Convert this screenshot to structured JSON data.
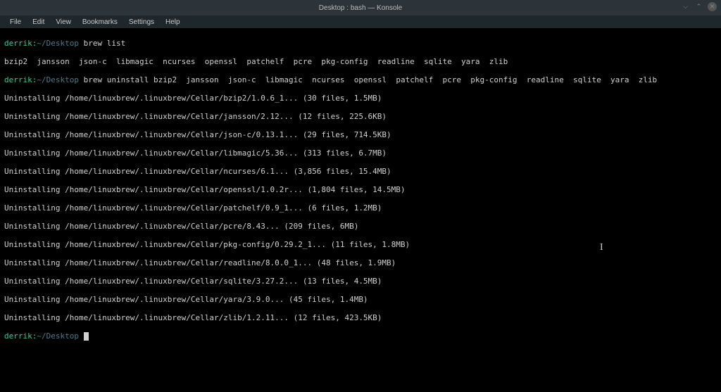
{
  "titlebar": {
    "title": "Desktop : bash — Konsole"
  },
  "window_controls": {
    "min": "⌵",
    "max": "⌃",
    "close": "✕"
  },
  "menubar": {
    "items": [
      "File",
      "Edit",
      "View",
      "Bookmarks",
      "Settings",
      "Help"
    ]
  },
  "prompt": {
    "user": "derrik",
    "sep1": ":",
    "path": "~/Desktop",
    "sep2": ""
  },
  "commands": {
    "c1": "brew list",
    "c2": "brew uninstall bzip2  jansson  json-c  libmagic  ncurses  openssl  patchelf  pcre  pkg-config  readline  sqlite  yara  zlib"
  },
  "output": {
    "list_line": "bzip2  jansson  json-c  libmagic  ncurses  openssl  patchelf  pcre  pkg-config  readline  sqlite  yara  zlib",
    "uninstall": [
      "Uninstalling /home/linuxbrew/.linuxbrew/Cellar/bzip2/1.0.6_1... (30 files, 1.5MB)",
      "Uninstalling /home/linuxbrew/.linuxbrew/Cellar/jansson/2.12... (12 files, 225.6KB)",
      "Uninstalling /home/linuxbrew/.linuxbrew/Cellar/json-c/0.13.1... (29 files, 714.5KB)",
      "Uninstalling /home/linuxbrew/.linuxbrew/Cellar/libmagic/5.36... (313 files, 6.7MB)",
      "Uninstalling /home/linuxbrew/.linuxbrew/Cellar/ncurses/6.1... (3,856 files, 15.4MB)",
      "Uninstalling /home/linuxbrew/.linuxbrew/Cellar/openssl/1.0.2r... (1,804 files, 14.5MB)",
      "Uninstalling /home/linuxbrew/.linuxbrew/Cellar/patchelf/0.9_1... (6 files, 1.2MB)",
      "Uninstalling /home/linuxbrew/.linuxbrew/Cellar/pcre/8.43... (209 files, 6MB)",
      "Uninstalling /home/linuxbrew/.linuxbrew/Cellar/pkg-config/0.29.2_1... (11 files, 1.8MB)",
      "Uninstalling /home/linuxbrew/.linuxbrew/Cellar/readline/8.0.0_1... (48 files, 1.9MB)",
      "Uninstalling /home/linuxbrew/.linuxbrew/Cellar/sqlite/3.27.2... (13 files, 4.5MB)",
      "Uninstalling /home/linuxbrew/.linuxbrew/Cellar/yara/3.9.0... (45 files, 1.4MB)",
      "Uninstalling /home/linuxbrew/.linuxbrew/Cellar/zlib/1.2.11... (12 files, 423.5KB)"
    ]
  }
}
